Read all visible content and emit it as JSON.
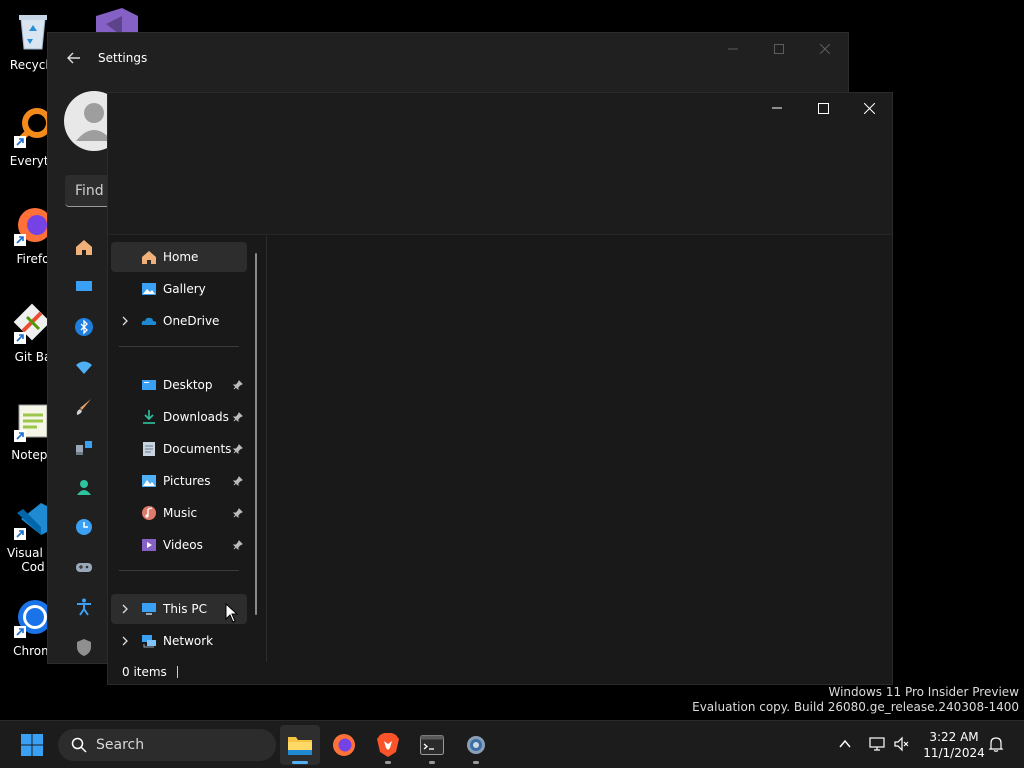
{
  "desktop": {
    "icons": [
      {
        "label": "Recycle"
      },
      {
        "label": "Everyth"
      },
      {
        "label": "Firefo"
      },
      {
        "label": "Git Ba"
      },
      {
        "label": "Notepa"
      },
      {
        "label": "Visual St\nCod"
      },
      {
        "label": "Chrom"
      }
    ]
  },
  "settings": {
    "title": "Settings",
    "find_placeholder": "Find a"
  },
  "explorer": {
    "nav": {
      "home": "Home",
      "gallery": "Gallery",
      "onedrive": "OneDrive",
      "desktop": "Desktop",
      "downloads": "Downloads",
      "documents": "Documents",
      "pictures": "Pictures",
      "music": "Music",
      "videos": "Videos",
      "this_pc": "This PC",
      "network": "Network"
    },
    "status": {
      "items": "0 items"
    }
  },
  "watermark": {
    "line1": "Windows 11 Pro Insider Preview",
    "line2": "Evaluation copy. Build 26080.ge_release.240308-1400"
  },
  "taskbar": {
    "search_label": "Search",
    "time": "3:22 AM",
    "date": "11/1/2024"
  },
  "colors": {
    "accent": "#0078d4",
    "taskbar_bg": "#1c1c1c",
    "window_bg": "#191919"
  }
}
